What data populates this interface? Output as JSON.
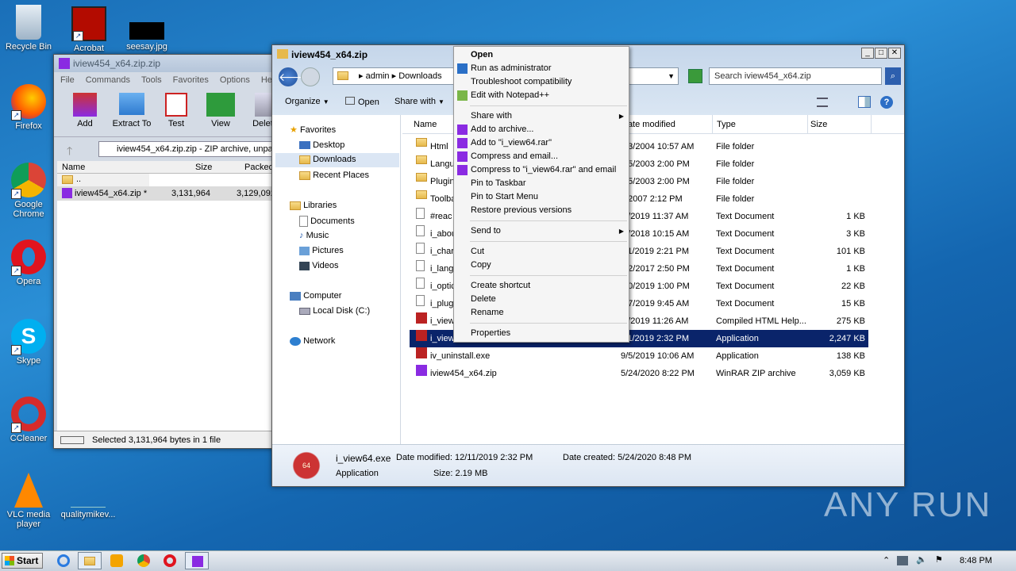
{
  "desktop": {
    "icons": [
      {
        "label": "Recycle Bin",
        "icon": "recycle-bin-icon"
      },
      {
        "label": "Acrobat",
        "icon": "acrobat-icon"
      },
      {
        "label": "seesay.jpg",
        "icon": "image-icon"
      },
      {
        "label": "Firefox",
        "icon": "firefox-icon"
      },
      {
        "label": "Google Chrome",
        "icon": "chrome-icon"
      },
      {
        "label": "Opera",
        "icon": "opera-icon"
      },
      {
        "label": "Skype",
        "icon": "skype-icon"
      },
      {
        "label": "CCleaner",
        "icon": "ccleaner-icon"
      },
      {
        "label": "VLC media player",
        "icon": "vlc-icon"
      },
      {
        "label": "qualitymikev...",
        "icon": "file-icon"
      }
    ]
  },
  "winrar": {
    "title": "iview454_x64.zip.zip",
    "menu": [
      "File",
      "Commands",
      "Tools",
      "Favorites",
      "Options",
      "Help"
    ],
    "tools": [
      "Add",
      "Extract To",
      "Test",
      "View",
      "Delete"
    ],
    "path": "iview454_x64.zip.zip - ZIP archive, unpa",
    "cols": [
      "Name",
      "Size",
      "Packed"
    ],
    "rows": [
      {
        "name": "..",
        "size": "",
        "packed": ""
      },
      {
        "name": "iview454_x64.zip *",
        "size": "3,131,964",
        "packed": "3,129,092"
      }
    ],
    "status": "Selected 3,131,964 bytes in 1 file"
  },
  "explorer": {
    "title": "iview454_x64.zip",
    "breadcrumb": [
      "admin",
      "Downloads"
    ],
    "search_placeholder": "Search iview454_x64.zip",
    "toolbar": [
      "Organize",
      "Open",
      "Share with"
    ],
    "nav": {
      "favorites": "Favorites",
      "fav_items": [
        "Desktop",
        "Downloads",
        "Recent Places"
      ],
      "libraries": "Libraries",
      "lib_items": [
        "Documents",
        "Music",
        "Pictures",
        "Videos"
      ],
      "computer": "Computer",
      "comp_items": [
        "Local Disk (C:)"
      ],
      "network": "Network"
    },
    "cols": [
      "Name",
      "Date modified",
      "Type",
      "Size"
    ],
    "files": [
      {
        "name": "Html",
        "date": "/13/2004 10:57 AM",
        "type": "File folder",
        "size": "",
        "kind": "folder"
      },
      {
        "name": "Langu",
        "date": "/25/2003 2:00 PM",
        "type": "File folder",
        "size": "",
        "kind": "folder"
      },
      {
        "name": "Plugin",
        "date": "/25/2003 2:00 PM",
        "type": "File folder",
        "size": "",
        "kind": "folder"
      },
      {
        "name": "Toolba",
        "date": "3/2007 2:12 PM",
        "type": "File folder",
        "size": "",
        "kind": "folder"
      },
      {
        "name": "#reac",
        "date": "/7/2019 11:37 AM",
        "type": "Text Document",
        "size": "1 KB",
        "kind": "doc"
      },
      {
        "name": "i_abou",
        "date": "/5/2018 10:15 AM",
        "type": "Text Document",
        "size": "3 KB",
        "kind": "doc"
      },
      {
        "name": "i_char",
        "date": "/11/2019 2:21 PM",
        "type": "Text Document",
        "size": "101 KB",
        "kind": "doc"
      },
      {
        "name": "i_lang",
        "date": "/12/2017 2:50 PM",
        "type": "Text Document",
        "size": "1 KB",
        "kind": "doc"
      },
      {
        "name": "i_optic",
        "date": "/10/2019 1:00 PM",
        "type": "Text Document",
        "size": "22 KB",
        "kind": "doc"
      },
      {
        "name": "i_plug",
        "date": "/17/2019 9:45 AM",
        "type": "Text Document",
        "size": "15 KB",
        "kind": "doc"
      },
      {
        "name": "i_view",
        "date": "/7/2019 11:26 AM",
        "type": "Compiled HTML Help...",
        "size": "275 KB",
        "kind": "help"
      },
      {
        "name": "i_view",
        "date": "/11/2019 2:32 PM",
        "type": "Application",
        "size": "2,247 KB",
        "kind": "app",
        "selected": true
      },
      {
        "name": "iv_uninstall.exe",
        "date": "9/5/2019 10:06 AM",
        "type": "Application",
        "size": "138 KB",
        "kind": "exe"
      },
      {
        "name": "iview454_x64.zip",
        "date": "5/24/2020 8:22 PM",
        "type": "WinRAR ZIP archive",
        "size": "3,059 KB",
        "kind": "zip"
      }
    ],
    "details": {
      "name": "i_view64.exe",
      "modified_label": "Date modified: 12/11/2019 2:32 PM",
      "created_label": "Date created: 5/24/2020 8:48 PM",
      "type": "Application",
      "size_label": "Size: 2.19 MB",
      "badge": "64"
    }
  },
  "context_menu": {
    "groups": [
      [
        "Open",
        "Run as administrator",
        "Troubleshoot compatibility",
        "Edit with Notepad++"
      ],
      [
        "Share with",
        "Add to archive...",
        "Add to \"i_view64.rar\"",
        "Compress and email...",
        "Compress to \"i_view64.rar\" and email",
        "Pin to Taskbar",
        "Pin to Start Menu",
        "Restore previous versions"
      ],
      [
        "Send to"
      ],
      [
        "Cut",
        "Copy"
      ],
      [
        "Create shortcut",
        "Delete",
        "Rename"
      ],
      [
        "Properties"
      ]
    ]
  },
  "taskbar": {
    "start": "Start",
    "clock": "8:48 PM"
  },
  "watermark": "ANY RUN"
}
